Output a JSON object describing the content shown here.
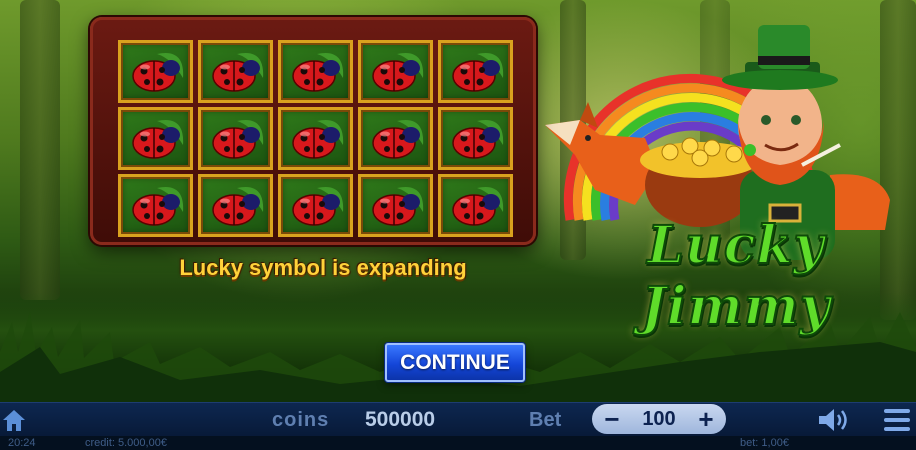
{
  "game": {
    "logo_text": "Lucky Jimmy",
    "status_message": "Lucky symbol is expanding",
    "continue_label": "CONTINUE"
  },
  "reels": {
    "rows": 3,
    "columns": 5,
    "symbol": "ladybug-icon",
    "cells": [
      [
        "ladybug",
        "ladybug",
        "ladybug",
        "ladybug",
        "ladybug"
      ],
      [
        "ladybug",
        "ladybug",
        "ladybug",
        "ladybug",
        "ladybug"
      ],
      [
        "ladybug",
        "ladybug",
        "ladybug",
        "ladybug",
        "ladybug"
      ]
    ]
  },
  "controls": {
    "coins_label": "coins",
    "coins_value": "500000",
    "bet_label": "Bet",
    "bet_value": "100",
    "minus_label": "−",
    "plus_label": "+"
  },
  "info": {
    "time": "20:24",
    "credit": "credit: 5.000,00€",
    "bet": "bet: 1,00€"
  },
  "icons": {
    "home": "home-icon",
    "sound": "speaker-icon",
    "menu": "hamburger-menu-icon"
  },
  "colors": {
    "status_text": "#ffd23a",
    "continue_button": "#1446d8",
    "bar_background": "#0d2750",
    "logo_green": "#5fdc2a"
  }
}
